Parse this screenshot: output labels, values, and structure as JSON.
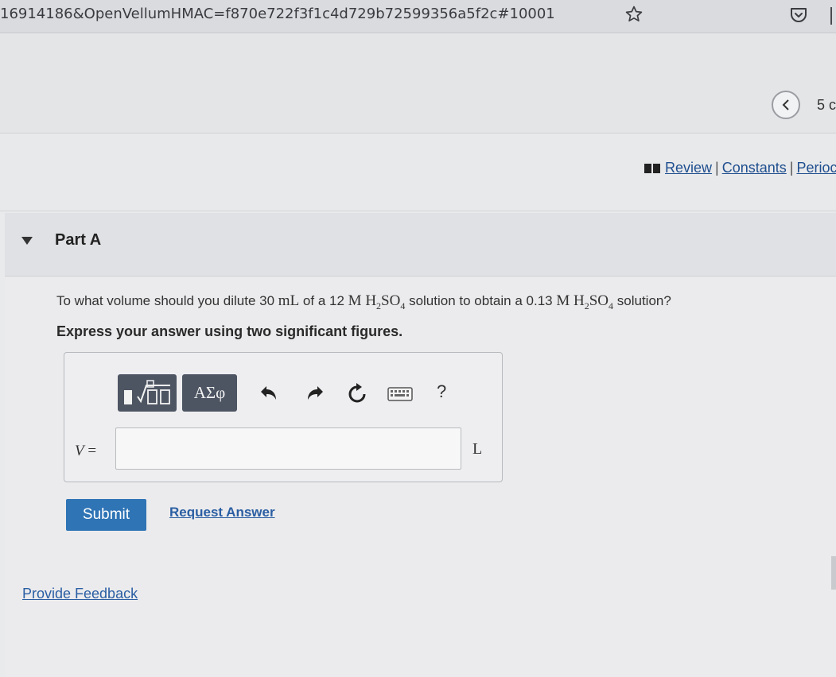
{
  "browser": {
    "url": "16914186&OpenVellumHMAC=f870e722f3f1c4d729b72599356a5f2c#10001"
  },
  "nav": {
    "page_count": "5 c"
  },
  "review": {
    "links": [
      "Review",
      "Constants",
      "Perioc"
    ],
    "separator": "|"
  },
  "part": {
    "title": "Part A"
  },
  "question": {
    "prefix": "To what volume should you dilute 30",
    "volume_unit": "mL",
    "mid1": "of a 12",
    "conc_unit": "M",
    "h": "H",
    "h_sub": "2",
    "so": "SO",
    "so_sub": "4",
    "mid2": "solution to obtain a 0.13",
    "suffix": "solution?"
  },
  "instruction": "Express your answer using two significant figures.",
  "toolbar": {
    "symbols_label": "ΑΣφ",
    "help_label": "?"
  },
  "answer": {
    "variable": "V",
    "equals": " =",
    "value": "",
    "placeholder": "",
    "unit": "L"
  },
  "actions": {
    "submit_label": "Submit",
    "request_answer_label": "Request Answer",
    "feedback_label": "Provide Feedback"
  },
  "colors": {
    "submit": "#2f74b5",
    "link": "#2a5ea3",
    "toolbar_button": "#4d5563"
  }
}
